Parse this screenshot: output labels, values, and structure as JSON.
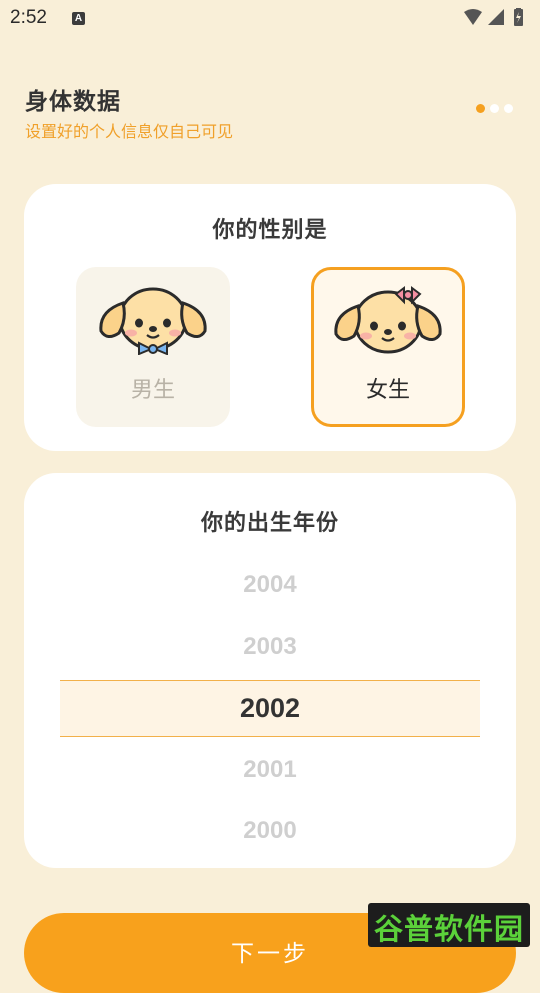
{
  "status_bar": {
    "time": "2:52",
    "notification_glyph": "A"
  },
  "header": {
    "title": "身体数据",
    "subtitle": "设置好的个人信息仅自己可见",
    "step_total": 3,
    "step_current": 1
  },
  "gender": {
    "question": "你的性别是",
    "options": [
      {
        "label": "男生",
        "selected": false
      },
      {
        "label": "女生",
        "selected": true
      }
    ]
  },
  "birth_year": {
    "question": "你的出生年份",
    "visible_years": [
      "2004",
      "2003",
      "2002",
      "2001",
      "2000"
    ],
    "selected": "2002"
  },
  "next_button": {
    "label": "下一步"
  },
  "watermark": {
    "text": "谷普软件园"
  },
  "colors": {
    "accent": "#f5a01f",
    "background": "#f9efd8",
    "card": "#ffffff"
  }
}
